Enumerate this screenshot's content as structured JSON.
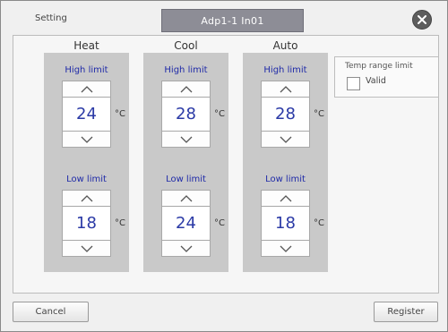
{
  "header": {
    "setting_label": "Setting",
    "unit_name": "Adp1-1 In01"
  },
  "columns": [
    {
      "title": "Heat",
      "high_label": "High limit",
      "high_value": "24",
      "low_label": "Low limit",
      "low_value": "18"
    },
    {
      "title": "Cool",
      "high_label": "High limit",
      "high_value": "28",
      "low_label": "Low limit",
      "low_value": "24"
    },
    {
      "title": "Auto",
      "high_label": "High limit",
      "high_value": "28",
      "low_label": "Low limit",
      "low_value": "18"
    }
  ],
  "unit_symbol": "°C",
  "temp_range": {
    "title": "Temp range limit",
    "valid_label": "Valid",
    "checked": false
  },
  "footer": {
    "cancel_label": "Cancel",
    "register_label": "Register"
  },
  "colors": {
    "accent_text": "#1f2aa8",
    "value_text": "#2b3aa6",
    "column_bg": "#c9c9c9",
    "tab_bg": "#8d8d96"
  },
  "icons": {
    "close": "close-icon",
    "up": "chevron-up-icon",
    "down": "chevron-down-icon"
  }
}
